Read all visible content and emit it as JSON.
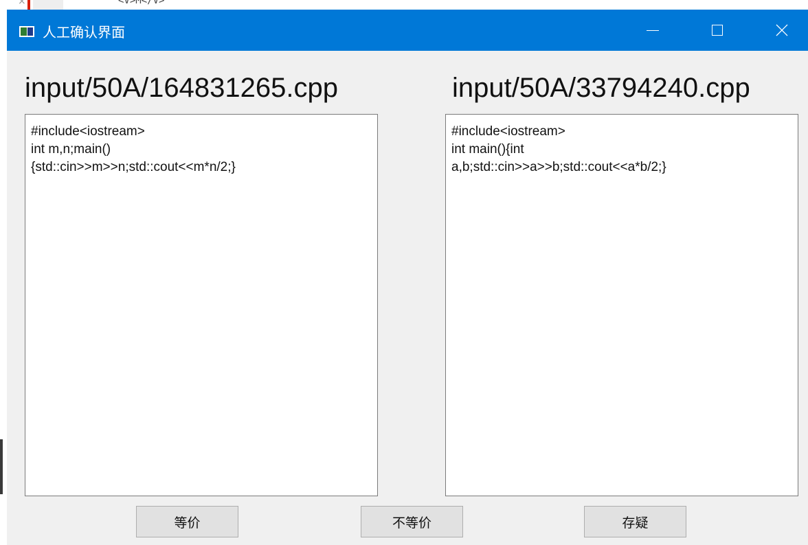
{
  "background_app": {
    "close_glyph": "×",
    "code_snippet": "<V>M</V>"
  },
  "window": {
    "title": "人工确认界面",
    "icon": "app-window-icon",
    "accent_color": "#0078d7",
    "controls": {
      "minimize": "minimize-icon",
      "maximize": "maximize-icon",
      "close_glyph": "✕"
    }
  },
  "left_file": {
    "path": "input/50A/164831265.cpp",
    "code_lines": [
      "#include<iostream>",
      "int m,n;main()",
      "{std::cin>>m>>n;std::cout<<m*n/2;}"
    ]
  },
  "right_file": {
    "path": "input/50A/33794240.cpp",
    "code_lines": [
      "#include<iostream>",
      "int main(){int",
      "a,b;std::cin>>a>>b;std::cout<<a*b/2;}"
    ]
  },
  "actions": {
    "equal_label": "等价",
    "not_equal_label": "不等价",
    "doubt_label": "存疑"
  }
}
